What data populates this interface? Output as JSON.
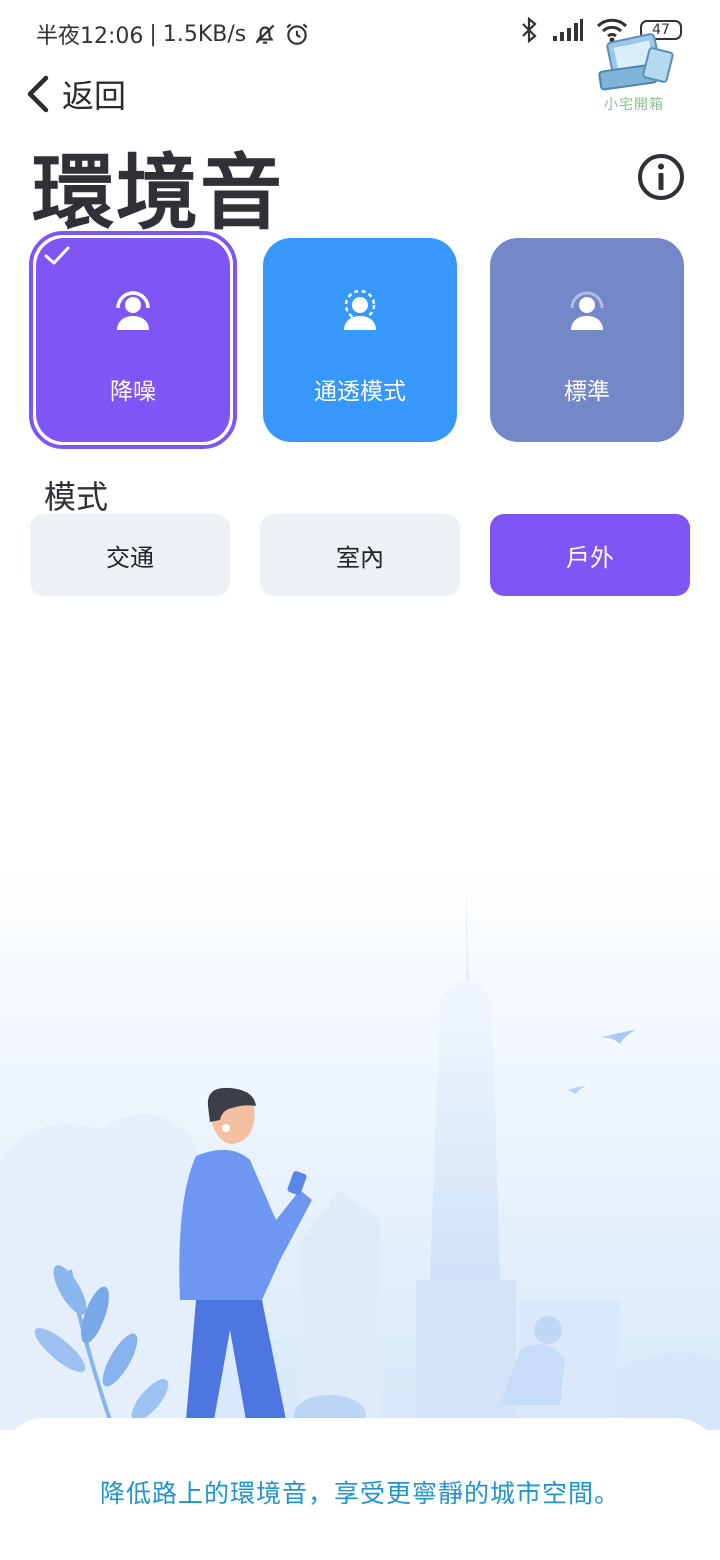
{
  "status_bar": {
    "time": "半夜12:06",
    "network_speed": "1.5KB/s",
    "battery": "47",
    "icons": [
      "mute-bell-icon",
      "alarm-icon",
      "bluetooth-icon",
      "signal-icon",
      "wifi-icon",
      "battery-icon"
    ]
  },
  "watermark": {
    "text": "小宅開箱"
  },
  "header": {
    "back_label": "返回",
    "title": "環境音",
    "info_icon": "info-icon"
  },
  "anc_modes": [
    {
      "label": "降噪",
      "color": "#7f55f5",
      "selected": true
    },
    {
      "label": "通透模式",
      "color": "#3897fb",
      "selected": false
    },
    {
      "label": "標準",
      "color": "#7387c9",
      "selected": false
    }
  ],
  "mode_section": {
    "heading": "模式",
    "options": [
      {
        "label": "交通",
        "selected": false
      },
      {
        "label": "室內",
        "selected": false
      },
      {
        "label": "戶外",
        "selected": true
      }
    ],
    "accent": "#7f55f5"
  },
  "description": "降低路上的環境音，享受更寧靜的城市空間。",
  "colors": {
    "accent_purple": "#7f55f5",
    "accent_blue": "#3897fb",
    "accent_slate": "#7387c9",
    "description_text": "#2193d1"
  }
}
